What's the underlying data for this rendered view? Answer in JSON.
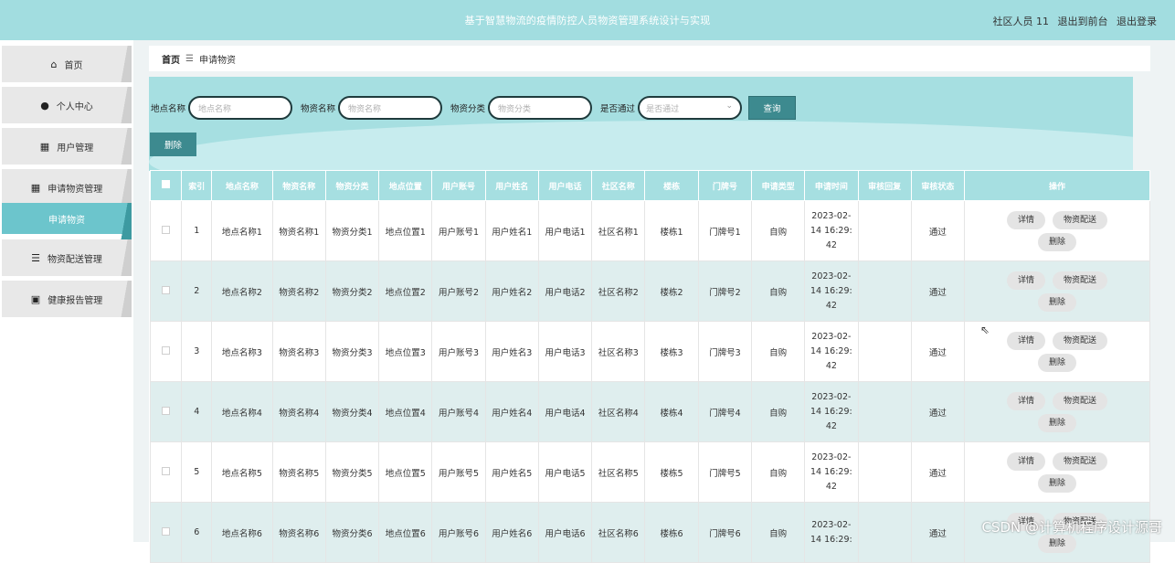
{
  "app": {
    "title": "基于智慧物流的疫情防控人员物资管理系统设计与实现",
    "user": "社区人员 11",
    "back_front": "退出到前台",
    "logout": "退出登录"
  },
  "sidebar": {
    "items": [
      {
        "label": "首页",
        "icon": "home-icon"
      },
      {
        "label": "个人中心",
        "icon": "user-icon"
      },
      {
        "label": "用户管理",
        "icon": "grid-icon"
      },
      {
        "label": "申请物资管理",
        "icon": "grid-icon"
      },
      {
        "label": "申请物资",
        "icon": ""
      },
      {
        "label": "物资配送管理",
        "icon": "sliders-icon"
      },
      {
        "label": "健康报告管理",
        "icon": "chart-icon"
      }
    ]
  },
  "breadcrumb": {
    "home": "首页",
    "sep": "☰",
    "current": "申请物资"
  },
  "search": {
    "place_label": "地点名称",
    "place_placeholder": "地点名称",
    "goods_label": "物资名称",
    "goods_placeholder": "物资名称",
    "category_label": "物资分类",
    "category_placeholder": "物资分类",
    "pass_label": "是否通过",
    "pass_placeholder": "是否通过",
    "query_button": "查询"
  },
  "toolbar": {
    "delete_button": "删除"
  },
  "table": {
    "headers": [
      "索引",
      "地点名称",
      "物资名称",
      "物资分类",
      "地点位置",
      "用户账号",
      "用户姓名",
      "用户电话",
      "社区名称",
      "楼栋",
      "门牌号",
      "申请类型",
      "申请时间",
      "审核回复",
      "审核状态",
      "操作"
    ],
    "rows": [
      {
        "index": "1",
        "place": "地点名称1",
        "goods": "物资名称1",
        "category": "物资分类1",
        "location": "地点位置1",
        "account": "用户账号1",
        "name": "用户姓名1",
        "phone": "用户电话1",
        "community": "社区名称1",
        "building": "楼栋1",
        "door": "门牌号1",
        "type": "自购",
        "time1": "2023-02-",
        "time2": "14 16:29:",
        "time3": "42",
        "reply": "",
        "status": "通过"
      },
      {
        "index": "2",
        "place": "地点名称2",
        "goods": "物资名称2",
        "category": "物资分类2",
        "location": "地点位置2",
        "account": "用户账号2",
        "name": "用户姓名2",
        "phone": "用户电话2",
        "community": "社区名称2",
        "building": "楼栋2",
        "door": "门牌号2",
        "type": "自购",
        "time1": "2023-02-",
        "time2": "14 16:29:",
        "time3": "42",
        "reply": "",
        "status": "通过"
      },
      {
        "index": "3",
        "place": "地点名称3",
        "goods": "物资名称3",
        "category": "物资分类3",
        "location": "地点位置3",
        "account": "用户账号3",
        "name": "用户姓名3",
        "phone": "用户电话3",
        "community": "社区名称3",
        "building": "楼栋3",
        "door": "门牌号3",
        "type": "自购",
        "time1": "2023-02-",
        "time2": "14 16:29:",
        "time3": "42",
        "reply": "",
        "status": "通过"
      },
      {
        "index": "4",
        "place": "地点名称4",
        "goods": "物资名称4",
        "category": "物资分类4",
        "location": "地点位置4",
        "account": "用户账号4",
        "name": "用户姓名4",
        "phone": "用户电话4",
        "community": "社区名称4",
        "building": "楼栋4",
        "door": "门牌号4",
        "type": "自购",
        "time1": "2023-02-",
        "time2": "14 16:29:",
        "time3": "42",
        "reply": "",
        "status": "通过"
      },
      {
        "index": "5",
        "place": "地点名称5",
        "goods": "物资名称5",
        "category": "物资分类5",
        "location": "地点位置5",
        "account": "用户账号5",
        "name": "用户姓名5",
        "phone": "用户电话5",
        "community": "社区名称5",
        "building": "楼栋5",
        "door": "门牌号5",
        "type": "自购",
        "time1": "2023-02-",
        "time2": "14 16:29:",
        "time3": "42",
        "reply": "",
        "status": "通过"
      },
      {
        "index": "6",
        "place": "地点名称6",
        "goods": "物资名称6",
        "category": "物资分类6",
        "location": "地点位置6",
        "account": "用户账号6",
        "name": "用户姓名6",
        "phone": "用户电话6",
        "community": "社区名称6",
        "building": "楼栋6",
        "door": "门牌号6",
        "type": "自购",
        "time1": "2023-02-",
        "time2": "14 16:29:",
        "time3": "",
        "reply": "",
        "status": "通过"
      }
    ],
    "actions": {
      "detail": "详情",
      "delivery": "物资配送",
      "delete": "删除"
    }
  },
  "watermark": "CSDN @计算机程序设计源哥",
  "colors": {
    "accent": "#a6dfe1",
    "button": "#3d8a8f",
    "active": "#6cc5cc"
  }
}
